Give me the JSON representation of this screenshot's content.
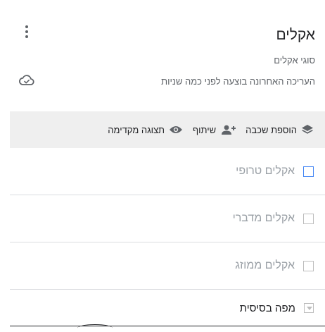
{
  "header": {
    "title": "אקלים",
    "subtitle": "סוגי אקלים",
    "edit_note": "העריכה האחרונה בוצעה לפני כמה שניות"
  },
  "toolbar": {
    "add_layer_label": "הוספת שכבה",
    "share_label": "שיתוף",
    "preview_label": "תצוגה מקדימה"
  },
  "layers": [
    {
      "label": "אקלים טרופי",
      "active": true
    },
    {
      "label": "אקלים מדברי",
      "active": false
    },
    {
      "label": "אקלים ממוזג",
      "active": false
    }
  ],
  "basemap": {
    "label": "מפה בסיסית"
  },
  "colors": {
    "accent": "#4285f4",
    "toolbar_bg": "#efefef",
    "muted_text": "#9aa0a6"
  },
  "icons": {
    "menu": "more-vert-icon",
    "cloud": "cloud-saved-icon",
    "add_layer": "layers-icon",
    "share": "add-person-icon",
    "preview": "eye-icon"
  }
}
